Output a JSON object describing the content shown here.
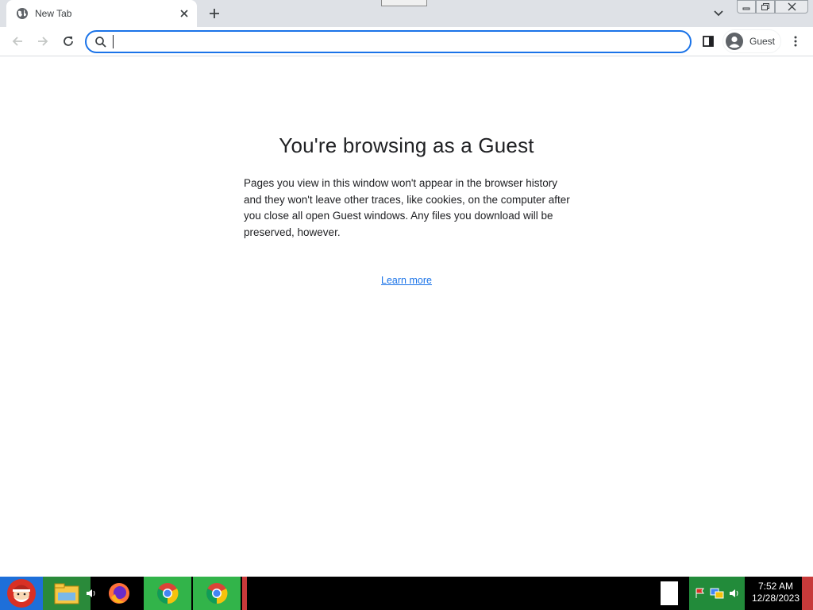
{
  "browser": {
    "tab": {
      "title": "New Tab",
      "favicon": "globe-icon"
    },
    "omnibox": {
      "value": "",
      "placeholder": ""
    },
    "profile": {
      "label": "Guest"
    }
  },
  "page": {
    "heading": "You're browsing as a Guest",
    "description": "Pages you view in this window won't appear in the browser history and they won't leave other traces, like cookies, on the computer after you close all open Guest windows. Any files you download will be preserved, however.",
    "learn_more": "Learn more"
  },
  "taskbar": {
    "apps": [
      "start-button",
      "file-explorer",
      "volume",
      "firefox",
      "chrome",
      "chrome"
    ],
    "clock": {
      "time": "7:52 AM",
      "date": "12/28/2023"
    }
  },
  "colors": {
    "accent": "#1a73e8",
    "tabstrip": "#dee1e6",
    "taskbar": "#000000",
    "taskbar_highlight": "#32b44a"
  }
}
